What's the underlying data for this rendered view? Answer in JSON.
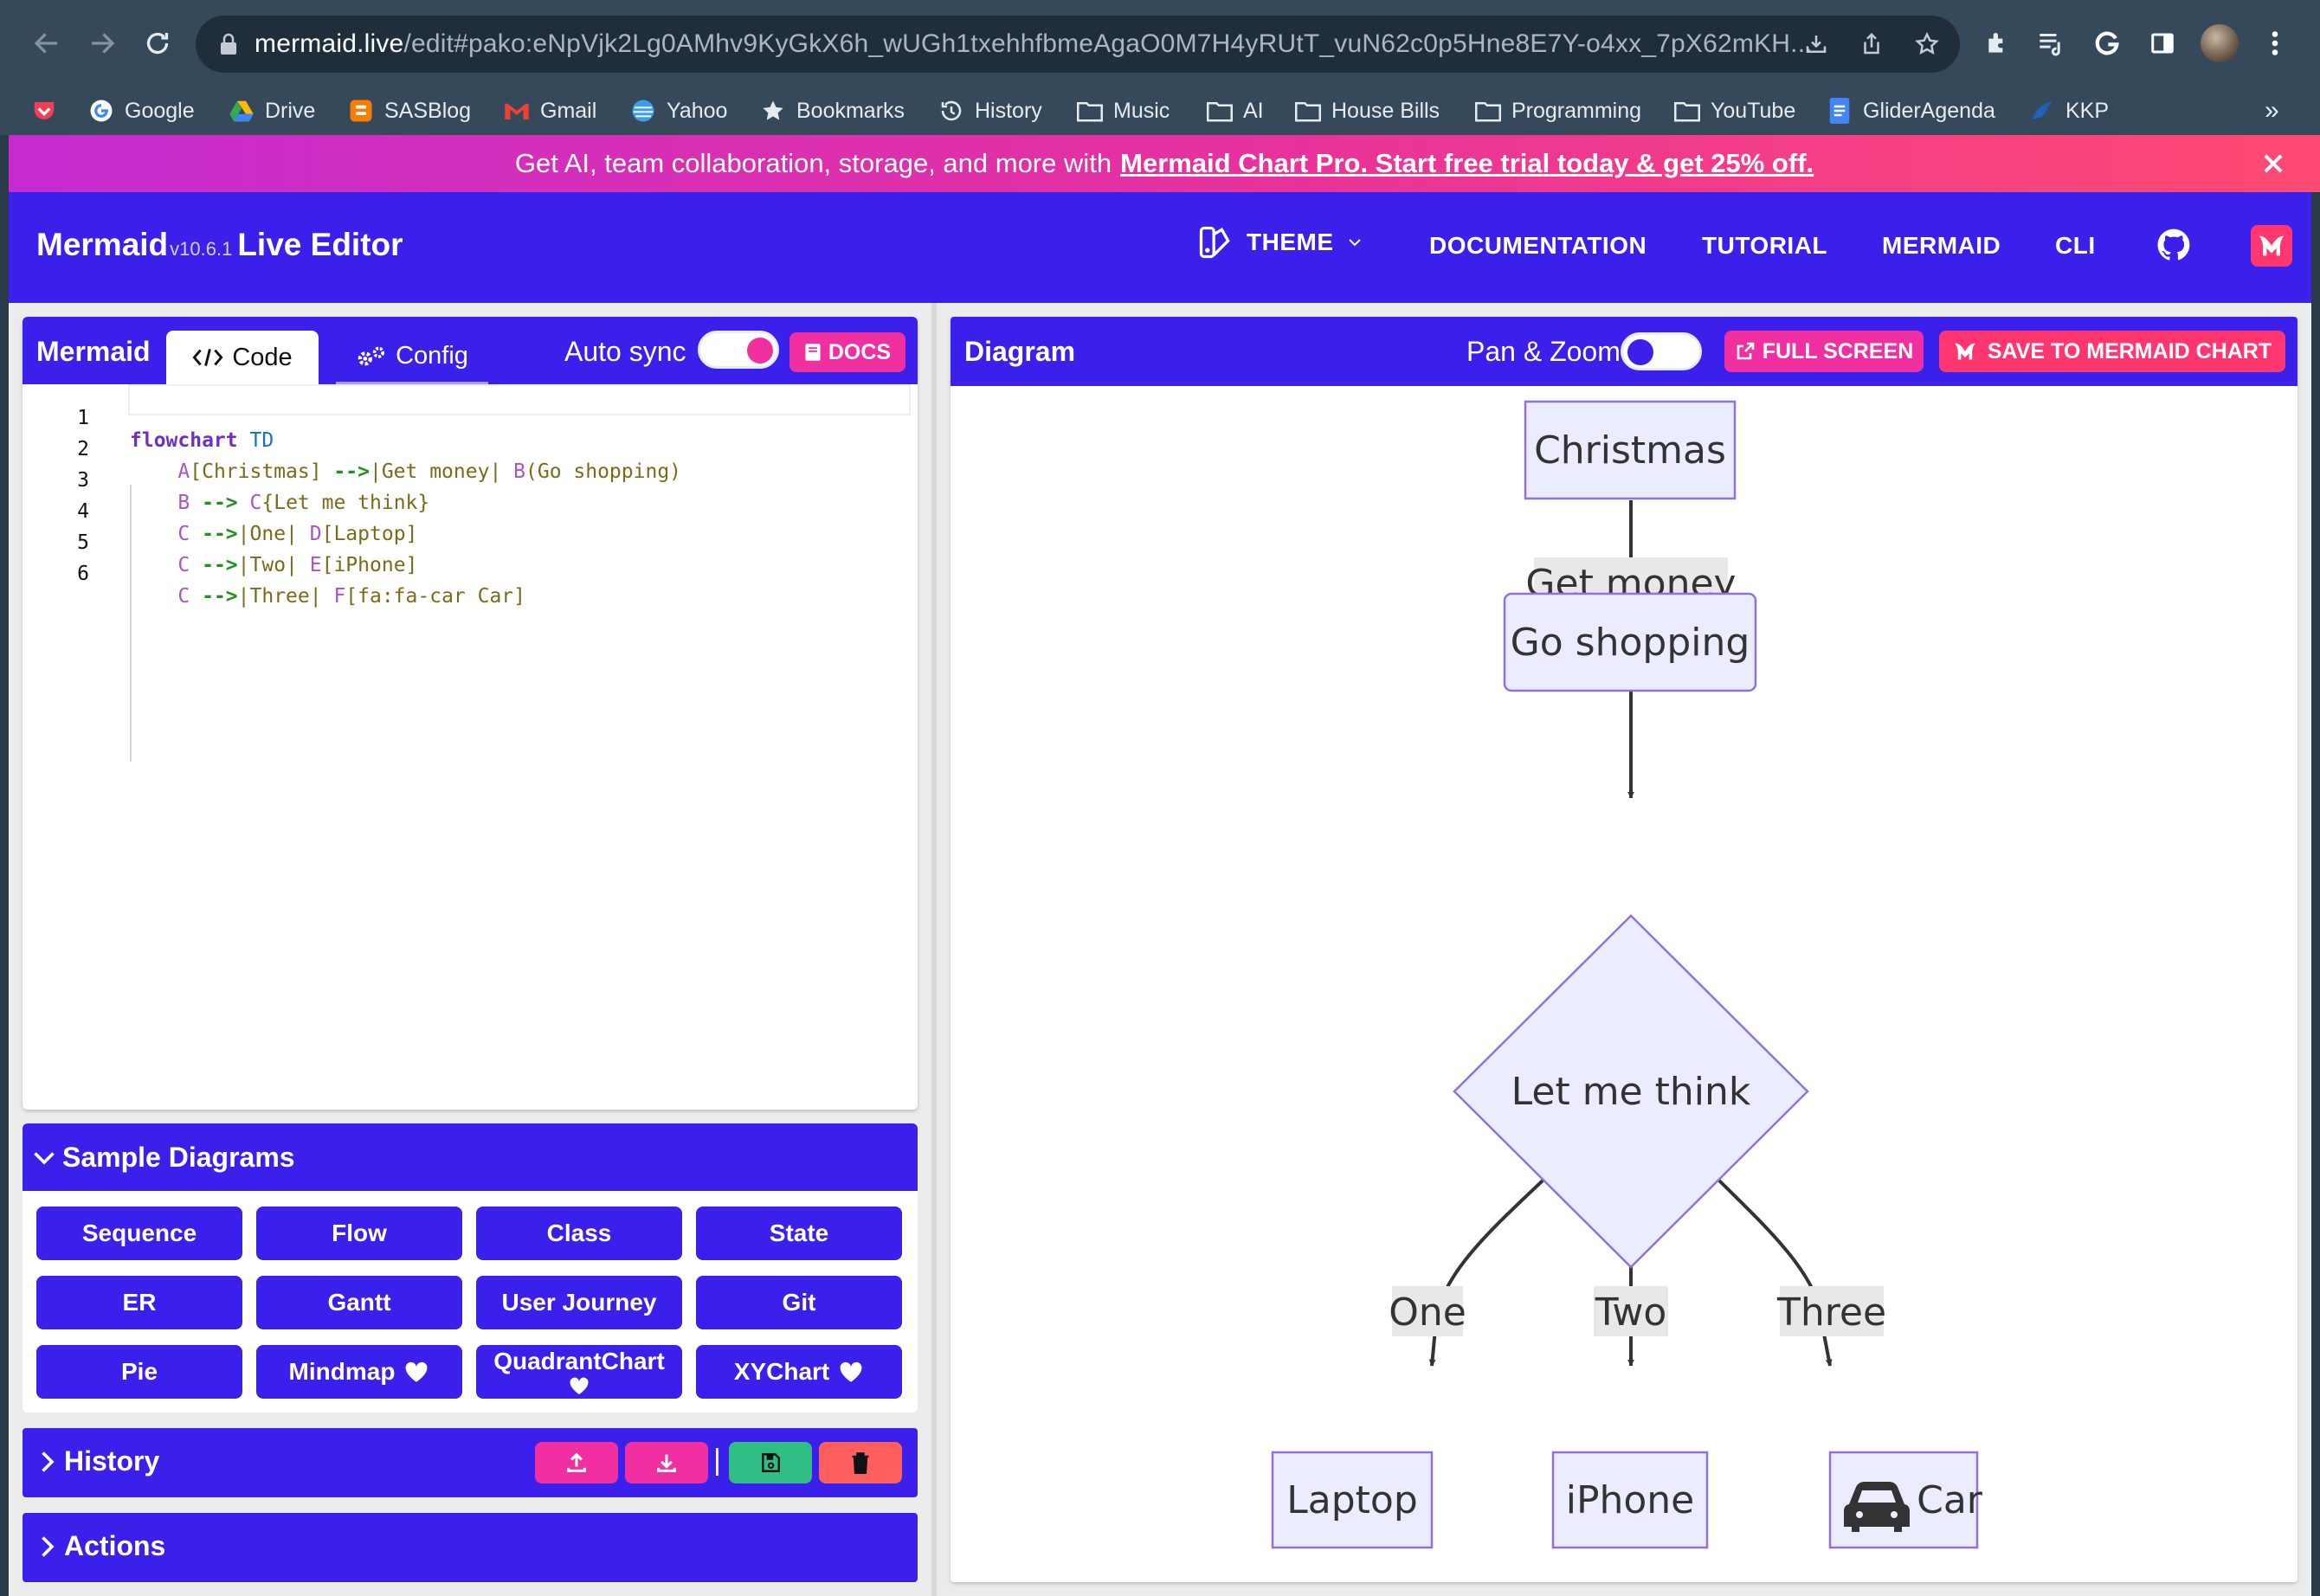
{
  "browser": {
    "url_host": "mermaid.live",
    "url_rest": "/edit#pako:eNpVjk2Lg0AMhv9KyGkX6h_wUGh1txehhfbmeAgaO0M7H4yRUtT_vuN62c0p5Hne8E7Y-o4xx_7pX62mKH...",
    "bookmarks": [
      {
        "label": "",
        "icon": "pocket-icon"
      },
      {
        "label": "Google",
        "icon": "google-icon"
      },
      {
        "label": "Drive",
        "icon": "drive-icon"
      },
      {
        "label": "SASBlog",
        "icon": "blogger-icon"
      },
      {
        "label": "Gmail",
        "icon": "gmail-icon"
      },
      {
        "label": "Yahoo",
        "icon": "yahoo-icon"
      },
      {
        "label": "Bookmarks",
        "icon": "star-icon"
      },
      {
        "label": "History",
        "icon": "history-icon"
      },
      {
        "label": "Music",
        "icon": "folder-icon"
      },
      {
        "label": "AI",
        "icon": "folder-icon"
      },
      {
        "label": "House Bills",
        "icon": "folder-icon"
      },
      {
        "label": "Programming",
        "icon": "folder-icon"
      },
      {
        "label": "YouTube",
        "icon": "folder-icon"
      },
      {
        "label": "GliderAgenda",
        "icon": "docs-icon"
      },
      {
        "label": "KKP",
        "icon": "kkp-icon"
      }
    ],
    "more_bookmarks": "»"
  },
  "promo": {
    "text": "Get AI, team collaboration, storage, and more with",
    "link": "Mermaid Chart Pro. Start free trial today & get 25% off."
  },
  "header": {
    "brand": "Mermaid",
    "version": "v10.6.1",
    "subtitle": "Live Editor",
    "nav": {
      "theme": "THEME",
      "documentation": "DOCUMENTATION",
      "tutorial": "TUTORIAL",
      "mermaid": "MERMAID",
      "cli": "CLI"
    }
  },
  "editor": {
    "title": "Mermaid",
    "tabs": {
      "code": "Code",
      "config": "Config"
    },
    "autosync_label": "Auto sync",
    "autosync_on": true,
    "docs_label": "DOCS",
    "line_numbers": [
      "1",
      "2",
      "3",
      "4",
      "5",
      "6"
    ],
    "code_lines": [
      "flowchart TD",
      "    A[Christmas] -->|Get money| B(Go shopping)",
      "    B --> C{Let me think}",
      "    C -->|One| D[Laptop]",
      "    C -->|Two| E[iPhone]",
      "    C -->|Three| F[fa:fa-car Car]"
    ]
  },
  "samples": {
    "title": "Sample Diagrams",
    "buttons": [
      {
        "label": "Sequence",
        "heart": false
      },
      {
        "label": "Flow",
        "heart": false
      },
      {
        "label": "Class",
        "heart": false
      },
      {
        "label": "State",
        "heart": false
      },
      {
        "label": "ER",
        "heart": false
      },
      {
        "label": "Gantt",
        "heart": false
      },
      {
        "label": "User Journey",
        "heart": false
      },
      {
        "label": "Git",
        "heart": false
      },
      {
        "label": "Pie",
        "heart": false
      },
      {
        "label": "Mindmap",
        "heart": true
      },
      {
        "label": "QuadrantChart",
        "heart": true
      },
      {
        "label": "XYChart",
        "heart": true
      }
    ]
  },
  "history": {
    "title": "History"
  },
  "actions": {
    "title": "Actions"
  },
  "diagram": {
    "title": "Diagram",
    "panzoom_label": "Pan & Zoom",
    "panzoom_on": false,
    "fullscreen_label": "FULL SCREEN",
    "save_label": "SAVE TO MERMAID CHART",
    "nodes": {
      "christmas": "Christmas",
      "go_shopping": "Go shopping",
      "let_me_think": "Let me think",
      "laptop": "Laptop",
      "iphone": "iPhone",
      "car": "Car"
    },
    "edge_labels": {
      "get_money": "Get money",
      "one": "One",
      "two": "Two",
      "three": "Three"
    }
  },
  "colors": {
    "primary": "#3b1fea",
    "accent_pink": "#f02fa1",
    "mermaid_chart_red": "#ff3670",
    "node_fill": "#ececff",
    "node_stroke": "#9370db",
    "history_green": "#2fbf84",
    "history_red": "#ff5f5f"
  }
}
